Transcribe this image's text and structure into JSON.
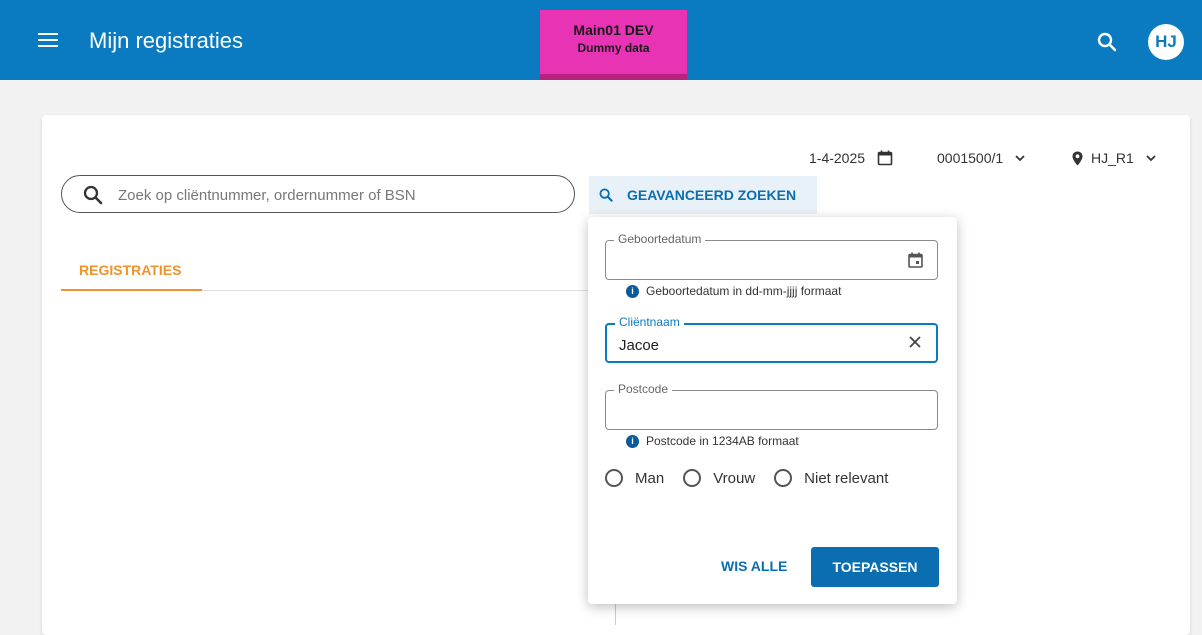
{
  "header": {
    "title": "Mijn registraties",
    "env_name": "Main01 DEV",
    "env_sub": "Dummy data",
    "avatar_initials": "HJ",
    "color": "#0a7bc0",
    "badge_color": "#e733b4"
  },
  "toolbar": {
    "date": "1-4-2025",
    "agreement": "0001500/1",
    "location": "HJ_R1"
  },
  "search": {
    "placeholder": "Zoek op cliëntnummer, ordernummer of BSN",
    "value": "",
    "advanced_label": "GEAVANCEERD ZOEKEN"
  },
  "tabs": [
    {
      "label": "REGISTRATIES",
      "active": true,
      "color": "#f0932b"
    }
  ],
  "advanced_panel": {
    "birthdate": {
      "label": "Geboortedatum",
      "value": "",
      "hint": "Geboortedatum in dd-mm-jjjj formaat"
    },
    "client_name": {
      "label": "Cliëntnaam",
      "value": "Jacoe"
    },
    "postcode": {
      "label": "Postcode",
      "value": "",
      "hint": "Postcode in 1234AB formaat"
    },
    "gender_options": [
      "Man",
      "Vrouw",
      "Niet relevant"
    ],
    "clear_label": "WIS ALLE",
    "apply_label": "TOEPASSEN"
  },
  "icons": [
    "menu-icon",
    "search-icon",
    "calendar-icon",
    "chevron-down-icon",
    "location-pin-icon",
    "info-icon",
    "close-icon"
  ]
}
